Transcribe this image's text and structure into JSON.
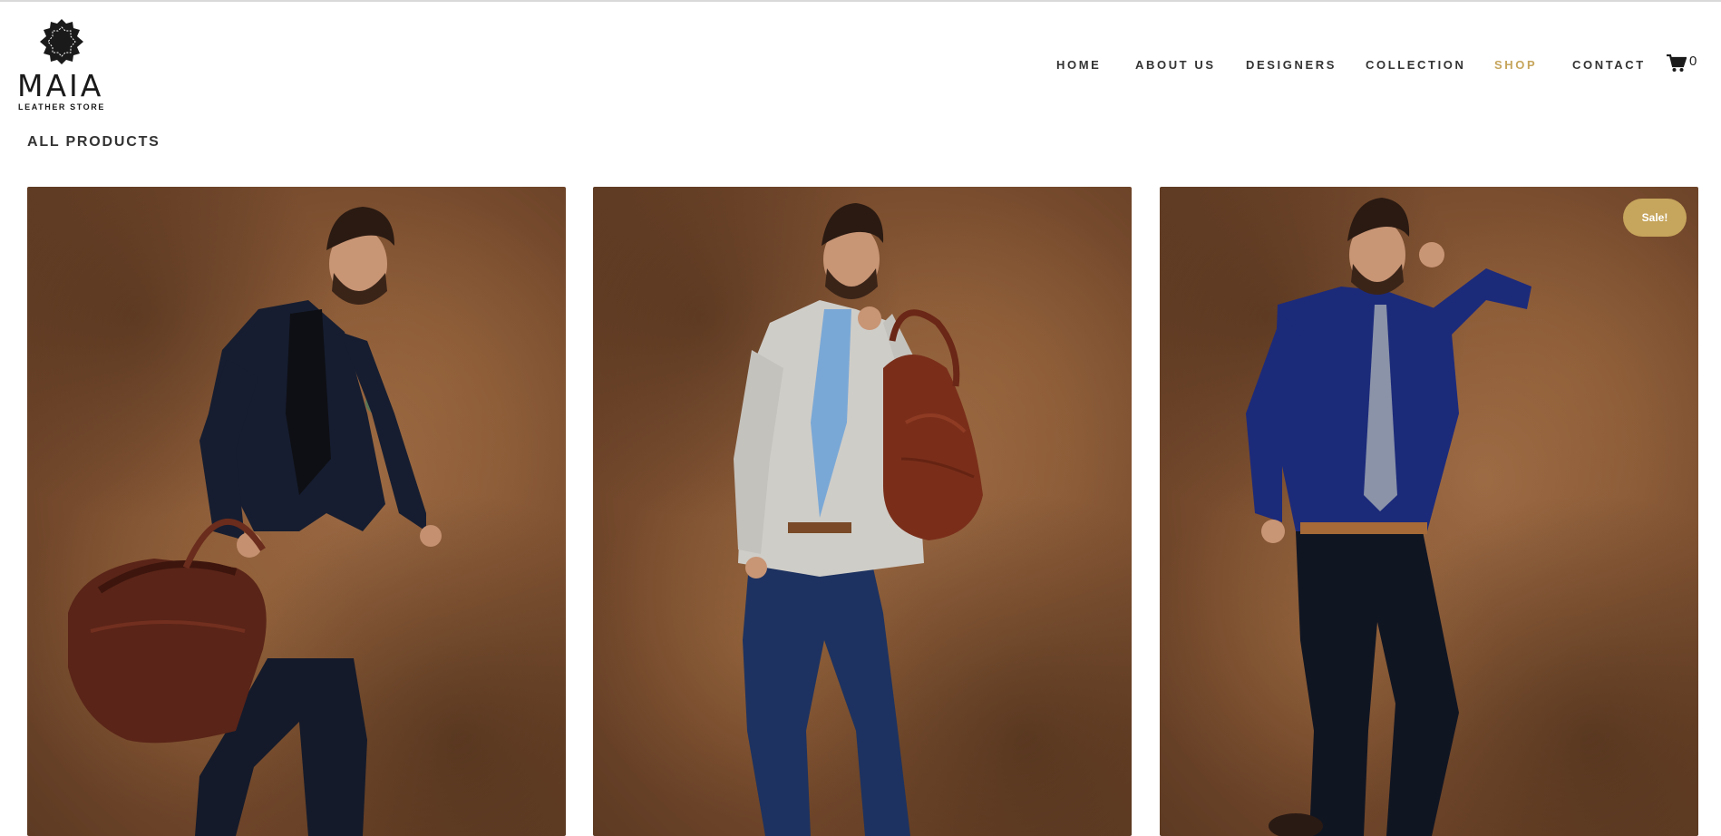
{
  "brand": {
    "name": "MAIA",
    "tagline": "LEATHER STORE"
  },
  "nav": {
    "items": [
      {
        "label": "HOME",
        "active": false
      },
      {
        "label": "ABOUT US",
        "active": false
      },
      {
        "label": "DESIGNERS",
        "active": false
      },
      {
        "label": "COLLECTION",
        "active": false
      },
      {
        "label": "SHOP",
        "active": true
      },
      {
        "label": "CONTACT",
        "active": false
      }
    ],
    "cart_count": "0"
  },
  "colors": {
    "accent": "#c6a55c",
    "text": "#333333",
    "background": "#ffffff"
  },
  "section": {
    "title": "ALL PRODUCTS"
  },
  "products": [
    {
      "image": "man-navy-suit-brown-leather-duffel",
      "sale": false
    },
    {
      "image": "man-grey-blazer-red-leather-tote",
      "sale": false
    },
    {
      "image": "man-denim-shirt-leather-belt",
      "sale": true,
      "badge": "Sale!"
    }
  ]
}
